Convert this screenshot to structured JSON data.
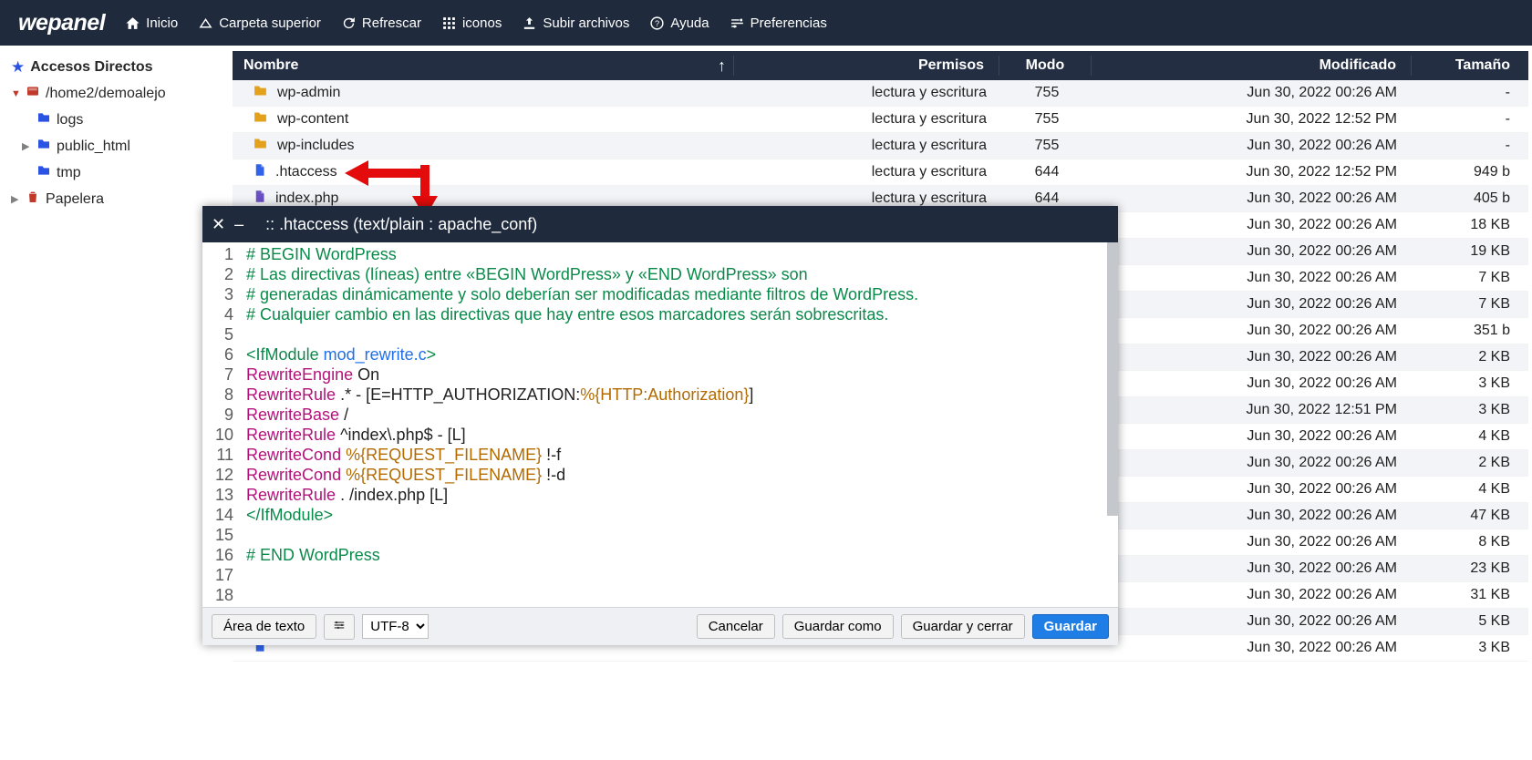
{
  "brand": "wepanel",
  "toolbar": {
    "home": "Inicio",
    "up": "Carpeta superior",
    "refresh": "Refrescar",
    "icons": "iconos",
    "upload": "Subir archivos",
    "help": "Ayuda",
    "prefs": "Preferencias"
  },
  "sidebar": {
    "shortcuts": "Accesos Directos",
    "root": "/home2/demoalejo",
    "folders": [
      "logs",
      "public_html",
      "tmp"
    ],
    "trash": "Papelera"
  },
  "columns": {
    "name": "Nombre",
    "perm": "Permisos",
    "mode": "Modo",
    "mod": "Modificado",
    "size": "Tamaño"
  },
  "rows": [
    {
      "icon": "folder",
      "name": "wp-admin",
      "perm": "lectura y escritura",
      "mode": "755",
      "mod": "Jun 30, 2022 00:26 AM",
      "size": "-"
    },
    {
      "icon": "folder",
      "name": "wp-content",
      "perm": "lectura y escritura",
      "mode": "755",
      "mod": "Jun 30, 2022 12:52 PM",
      "size": "-"
    },
    {
      "icon": "folder",
      "name": "wp-includes",
      "perm": "lectura y escritura",
      "mode": "755",
      "mod": "Jun 30, 2022 00:26 AM",
      "size": "-"
    },
    {
      "icon": "file",
      "name": ".htaccess",
      "perm": "lectura y escritura",
      "mode": "644",
      "mod": "Jun 30, 2022 12:52 PM",
      "size": "949 b"
    },
    {
      "icon": "filep",
      "name": "index.php",
      "perm": "lectura y escritura",
      "mode": "644",
      "mod": "Jun 30, 2022 00:26 AM",
      "size": "405 b"
    },
    {
      "icon": "file",
      "name": "",
      "perm": "",
      "mode": "",
      "mod": "Jun 30, 2022 00:26 AM",
      "size": "18 KB"
    },
    {
      "icon": "file",
      "name": "",
      "perm": "",
      "mode": "",
      "mod": "Jun 30, 2022 00:26 AM",
      "size": "19 KB"
    },
    {
      "icon": "file",
      "name": "",
      "perm": "",
      "mode": "",
      "mod": "Jun 30, 2022 00:26 AM",
      "size": "7 KB"
    },
    {
      "icon": "file",
      "name": "",
      "perm": "",
      "mode": "",
      "mod": "Jun 30, 2022 00:26 AM",
      "size": "7 KB"
    },
    {
      "icon": "file",
      "name": "",
      "perm": "",
      "mode": "",
      "mod": "Jun 30, 2022 00:26 AM",
      "size": "351 b"
    },
    {
      "icon": "file",
      "name": "",
      "perm": "",
      "mode": "",
      "mod": "Jun 30, 2022 00:26 AM",
      "size": "2 KB"
    },
    {
      "icon": "file",
      "name": "",
      "perm": "",
      "mode": "",
      "mod": "Jun 30, 2022 00:26 AM",
      "size": "3 KB"
    },
    {
      "icon": "file",
      "name": "",
      "perm": "",
      "mode": "",
      "mod": "Jun 30, 2022 12:51 PM",
      "size": "3 KB"
    },
    {
      "icon": "file",
      "name": "",
      "perm": "",
      "mode": "",
      "mod": "Jun 30, 2022 00:26 AM",
      "size": "4 KB"
    },
    {
      "icon": "file",
      "name": "",
      "perm": "",
      "mode": "",
      "mod": "Jun 30, 2022 00:26 AM",
      "size": "2 KB"
    },
    {
      "icon": "file",
      "name": "",
      "perm": "",
      "mode": "",
      "mod": "Jun 30, 2022 00:26 AM",
      "size": "4 KB"
    },
    {
      "icon": "file",
      "name": "",
      "perm": "",
      "mode": "",
      "mod": "Jun 30, 2022 00:26 AM",
      "size": "47 KB"
    },
    {
      "icon": "file",
      "name": "",
      "perm": "",
      "mode": "",
      "mod": "Jun 30, 2022 00:26 AM",
      "size": "8 KB"
    },
    {
      "icon": "file",
      "name": "",
      "perm": "",
      "mode": "",
      "mod": "Jun 30, 2022 00:26 AM",
      "size": "23 KB"
    },
    {
      "icon": "file",
      "name": "",
      "perm": "",
      "mode": "",
      "mod": "Jun 30, 2022 00:26 AM",
      "size": "31 KB"
    },
    {
      "icon": "file",
      "name": "",
      "perm": "",
      "mode": "",
      "mod": "Jun 30, 2022 00:26 AM",
      "size": "5 KB"
    },
    {
      "icon": "file",
      "name": "",
      "perm": "",
      "mode": "",
      "mod": "Jun 30, 2022 00:26 AM",
      "size": "3 KB"
    }
  ],
  "editor": {
    "title": ":: .htaccess (text/plain : apache_conf)",
    "lines": [
      [
        {
          "c": "comment",
          "t": "# BEGIN WordPress"
        }
      ],
      [
        {
          "c": "comment",
          "t": "# Las directivas (líneas) entre «BEGIN WordPress» y «END WordPress» son"
        }
      ],
      [
        {
          "c": "comment",
          "t": "# generadas dinámicamente y solo deberían ser modificadas mediante filtros de WordPress."
        }
      ],
      [
        {
          "c": "comment",
          "t": "# Cualquier cambio en las directivas que hay entre esos marcadores serán sobrescritas."
        }
      ],
      [],
      [
        {
          "c": "tag",
          "t": "<IfModule "
        },
        {
          "c": "attr",
          "t": "mod_rewrite.c"
        },
        {
          "c": "tag",
          "t": ">"
        }
      ],
      [
        {
          "c": "keyword",
          "t": "RewriteEngine"
        },
        {
          "c": "plain",
          "t": " On"
        }
      ],
      [
        {
          "c": "keyword",
          "t": "RewriteRule"
        },
        {
          "c": "plain",
          "t": " .* - [E=HTTP_AUTHORIZATION:"
        },
        {
          "c": "var",
          "t": "%{HTTP:Authorization}"
        },
        {
          "c": "plain",
          "t": "]"
        }
      ],
      [
        {
          "c": "keyword",
          "t": "RewriteBase"
        },
        {
          "c": "plain",
          "t": " /"
        }
      ],
      [
        {
          "c": "keyword",
          "t": "RewriteRule"
        },
        {
          "c": "plain",
          "t": " ^index\\.php$ - [L]"
        }
      ],
      [
        {
          "c": "keyword",
          "t": "RewriteCond"
        },
        {
          "c": "plain",
          "t": " "
        },
        {
          "c": "var",
          "t": "%{REQUEST_FILENAME}"
        },
        {
          "c": "plain",
          "t": " !-f"
        }
      ],
      [
        {
          "c": "keyword",
          "t": "RewriteCond"
        },
        {
          "c": "plain",
          "t": " "
        },
        {
          "c": "var",
          "t": "%{REQUEST_FILENAME}"
        },
        {
          "c": "plain",
          "t": " !-d"
        }
      ],
      [
        {
          "c": "keyword",
          "t": "RewriteRule"
        },
        {
          "c": "plain",
          "t": " . /index.php [L]"
        }
      ],
      [
        {
          "c": "tag",
          "t": "</IfModule>"
        }
      ],
      [],
      [
        {
          "c": "comment",
          "t": "# END WordPress"
        }
      ],
      [],
      []
    ],
    "footer": {
      "textarea": "Área de texto",
      "encoding": "UTF-8",
      "cancel": "Cancelar",
      "saveas": "Guardar como",
      "saveclose": "Guardar y cerrar",
      "save": "Guardar"
    }
  }
}
